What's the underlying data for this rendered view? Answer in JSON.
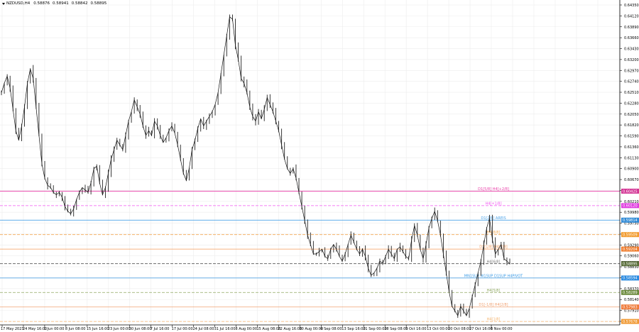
{
  "symbol": "NZDUSD,H4",
  "ohlc": [
    "0.58876",
    "0.58941",
    "0.58842",
    "0.58895"
  ],
  "price_axis": {
    "labels": [
      "0.64350",
      "0.64120",
      "0.63890",
      "0.63660",
      "0.63430",
      "0.63200",
      "0.62970",
      "0.62740",
      "0.62510",
      "0.62280",
      "0.62050",
      "0.61820",
      "0.61590",
      "0.61360",
      "0.61130",
      "0.60900",
      "0.60670",
      "0.60440",
      "0.60210",
      "0.59980",
      "0.59750",
      "0.59520",
      "0.59290",
      "0.59060",
      "0.58830",
      "0.58600",
      "0.58370",
      "0.58140",
      "0.57910",
      "0.57680"
    ]
  },
  "time_axis": {
    "labels": [
      "17 May 2023",
      "24 May 16:00",
      "1 Jun 00:00",
      "8 Jun 08:00",
      "15 Jun 16:00",
      "23 Jun 00:00",
      "30 Jun 08:00",
      "7 Jul 16:00",
      "17 Jul 00:00",
      "24 Jul 08:00",
      "31 Jul 16:00",
      "8 Aug 00:00",
      "15 Aug 08:00",
      "22 Aug 16:00",
      "30 Aug 00:00",
      "6 Sep 08:00",
      "13 Sep 16:00",
      "21 Sep 00:00",
      "28 Sep 08:00",
      "5 Oct 16:00",
      "13 Oct 00:00",
      "20 Oct 08:00",
      "27 Oct 16:00",
      "6 Nov 00:00"
    ]
  },
  "levels": [
    {
      "name": "D1[5/8] H4[+2/8]",
      "price": "0.60425",
      "color": "#ea3ea8",
      "style": "solid",
      "tag_color": "#d43796"
    },
    {
      "name": "H4[+1/8]",
      "price": "0.60120",
      "color": "#f257f2",
      "style": "dashed",
      "tag_color": "#e03ce0"
    },
    {
      "name": "D1[2/8] AREIS",
      "price": "0.59814",
      "color": "#4aa2e8",
      "style": "solid",
      "tag_color": "#2f8ad6"
    },
    {
      "name": "H4[8/8]",
      "price": "0.59509",
      "color": "#f5ab57",
      "style": "dashed",
      "tag_color": "#f29b2e"
    },
    {
      "name": "D1[1/8] H4[7/8]",
      "price": "0.59204",
      "color": "#f39a58",
      "style": "solid",
      "tag_color": "#ef7d2f"
    },
    {
      "name": "",
      "price": "0.58899",
      "color": "#555555",
      "style": "dashed",
      "tag_color": "#3a3a3a"
    },
    {
      "name": "H4[6/8]",
      "price": "0.58895",
      "color": "#7a7a7a",
      "style": "dashed",
      "tag_color": "#5a6e3a"
    },
    {
      "name": "MN1SUP W1SUP D1SUP H4PIVOT",
      "price": "0.58594",
      "color": "#3b9be6",
      "style": "solid",
      "tag_color": "#2a8ae0"
    },
    {
      "name": "H4[5/8]",
      "price": "0.58289",
      "color": "#8fa860",
      "style": "dashed",
      "tag_color": "#6b8a3c"
    },
    {
      "name": "D1[-1/8] H4[2/8]",
      "price": "0.57983",
      "color": "#f0a070",
      "style": "solid",
      "tag_color": "#ef7a3a"
    },
    {
      "name": "H4[1/8]",
      "price": "0.57678",
      "color": "#f5b26a",
      "style": "dashed",
      "tag_color": "#f09a35"
    }
  ],
  "series": [
    0.625,
    0.627,
    0.6285,
    0.626,
    0.6215,
    0.617,
    0.615,
    0.618,
    0.622,
    0.627,
    0.63,
    0.628,
    0.622,
    0.616,
    0.61,
    0.607,
    0.6055,
    0.605,
    0.604,
    0.6035,
    0.604,
    0.603,
    0.601,
    0.6,
    0.5995,
    0.6005,
    0.6025,
    0.604,
    0.605,
    0.6045,
    0.604,
    0.606,
    0.609,
    0.6095,
    0.606,
    0.6035,
    0.605,
    0.608,
    0.611,
    0.613,
    0.615,
    0.614,
    0.613,
    0.616,
    0.619,
    0.621,
    0.6235,
    0.622,
    0.6205,
    0.618,
    0.616,
    0.617,
    0.616,
    0.619,
    0.618,
    0.616,
    0.6145,
    0.6155,
    0.617,
    0.618,
    0.6165,
    0.614,
    0.611,
    0.608,
    0.6065,
    0.609,
    0.613,
    0.615,
    0.6175,
    0.6195,
    0.618,
    0.619,
    0.62,
    0.621,
    0.6225,
    0.625,
    0.629,
    0.633,
    0.637,
    0.641,
    0.6405,
    0.635,
    0.632,
    0.628,
    0.627,
    0.625,
    0.622,
    0.62,
    0.619,
    0.621,
    0.6195,
    0.6215,
    0.624,
    0.6225,
    0.621,
    0.619,
    0.617,
    0.614,
    0.611,
    0.609,
    0.608,
    0.609,
    0.607,
    0.604,
    0.601,
    0.598,
    0.595,
    0.593,
    0.591,
    0.591,
    0.5915,
    0.592,
    0.5905,
    0.59,
    0.592,
    0.593,
    0.592,
    0.5905,
    0.5895,
    0.591,
    0.593,
    0.595,
    0.5935,
    0.592,
    0.591,
    0.592,
    0.5905,
    0.588,
    0.5865,
    0.587,
    0.588,
    0.5895,
    0.589,
    0.5905,
    0.592,
    0.591,
    0.59,
    0.592,
    0.5925,
    0.5915,
    0.5905,
    0.59,
    0.594,
    0.597,
    0.595,
    0.592,
    0.59,
    0.593,
    0.5965,
    0.5985,
    0.6,
    0.598,
    0.595,
    0.591,
    0.587,
    0.583,
    0.58,
    0.579,
    0.578,
    0.58,
    0.579,
    0.578,
    0.5795,
    0.582,
    0.5845,
    0.587,
    0.5895,
    0.593,
    0.5965,
    0.5985,
    0.594,
    0.591,
    0.592,
    0.593,
    0.59,
    0.5895,
    0.58895
  ]
}
